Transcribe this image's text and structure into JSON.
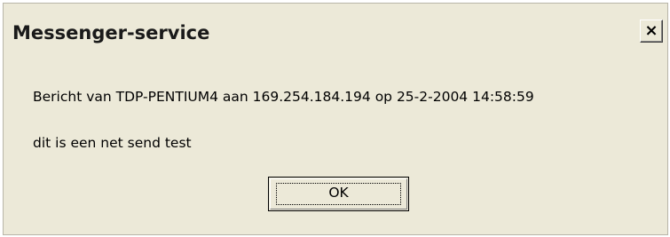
{
  "window": {
    "title": "Messenger-service",
    "close_label": "×"
  },
  "message": {
    "header": "Bericht van TDP-PENTIUM4 aan 169.254.184.194 op 25-2-2004 14:58:59",
    "body": "dit is een net send test"
  },
  "buttons": {
    "ok_label": "OK"
  }
}
